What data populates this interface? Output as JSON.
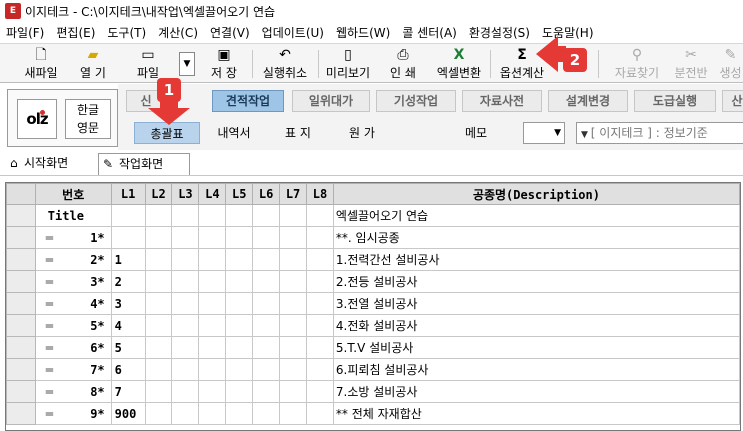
{
  "window": {
    "title": "이지테크 - C:\\이지테크\\내작업\\엑셀끌어오기 연습",
    "icon_text": "E"
  },
  "menu": [
    {
      "label": "파일(F)"
    },
    {
      "label": "편집(E)"
    },
    {
      "label": "도구(T)"
    },
    {
      "label": "계산(C)"
    },
    {
      "label": "연결(V)"
    },
    {
      "label": "업데이트(U)"
    },
    {
      "label": "웹하드(W)"
    },
    {
      "label": "콜 센터(A)"
    },
    {
      "label": "환경설정(S)"
    },
    {
      "label": "도움말(H)"
    }
  ],
  "toolbar": {
    "new_file": "새파일",
    "open": "열 기",
    "file_drop": "파일",
    "save": "저 장",
    "undo": "실행취소",
    "preview": "미리보기",
    "print": "인 쇄",
    "excel": "엑셀변환",
    "option_calc": "옵션계산",
    "data_search": "자료찾기",
    "split": "분전반",
    "generate": "생성"
  },
  "left_panel": {
    "logo": "olz",
    "lang_korean": "한글",
    "lang_english": "영문"
  },
  "tabs": [
    {
      "label": "견적작업"
    },
    {
      "label": "일위대가"
    },
    {
      "label": "기성작업"
    },
    {
      "label": "자료사전"
    },
    {
      "label": "설계변경"
    },
    {
      "label": "도급실행"
    },
    {
      "label": "산"
    }
  ],
  "tab_first_partial": "신",
  "subtabs": [
    {
      "label": "총괄표"
    },
    {
      "label": "내역서"
    },
    {
      "label": "표 지"
    },
    {
      "label": "원 가"
    }
  ],
  "memo_label": "메모",
  "info_field": "[ 이지테크 ] : 정보기준",
  "screen_tabs": {
    "start": "시작화면",
    "work": "작업화면"
  },
  "grid": {
    "headers": {
      "num": "번호",
      "l1": "L1",
      "l2": "L2",
      "l3": "L3",
      "l4": "L4",
      "l5": "L5",
      "l6": "L6",
      "l7": "L7",
      "l8": "L8",
      "desc": "공종명(Description)"
    },
    "rows": [
      {
        "num": "Title",
        "l1": "",
        "desc": "엑셀끌어오기 연습",
        "handle": false
      },
      {
        "num": "1*",
        "l1": "",
        "desc": "**. 임시공종",
        "handle": true
      },
      {
        "num": "2*",
        "l1": "1",
        "desc": "1.전력간선 설비공사",
        "handle": true
      },
      {
        "num": "3*",
        "l1": "2",
        "desc": "2.전등 설비공사",
        "handle": true
      },
      {
        "num": "4*",
        "l1": "3",
        "desc": "3.전열 설비공사",
        "handle": true
      },
      {
        "num": "5*",
        "l1": "4",
        "desc": "4.전화 설비공사",
        "handle": true
      },
      {
        "num": "6*",
        "l1": "5",
        "desc": "5.T.V 설비공사",
        "handle": true
      },
      {
        "num": "7*",
        "l1": "6",
        "desc": "6.피뢰침 설비공사",
        "handle": true
      },
      {
        "num": "8*",
        "l1": "7",
        "desc": "7.소방 설비공사",
        "handle": true
      },
      {
        "num": "9*",
        "l1": "900",
        "desc": "** 전체 자재합산",
        "handle": true
      }
    ]
  },
  "callouts": {
    "one": "1",
    "two": "2"
  },
  "colors": {
    "accent_tab": "#9ec4e6",
    "callout": "#e53935"
  }
}
